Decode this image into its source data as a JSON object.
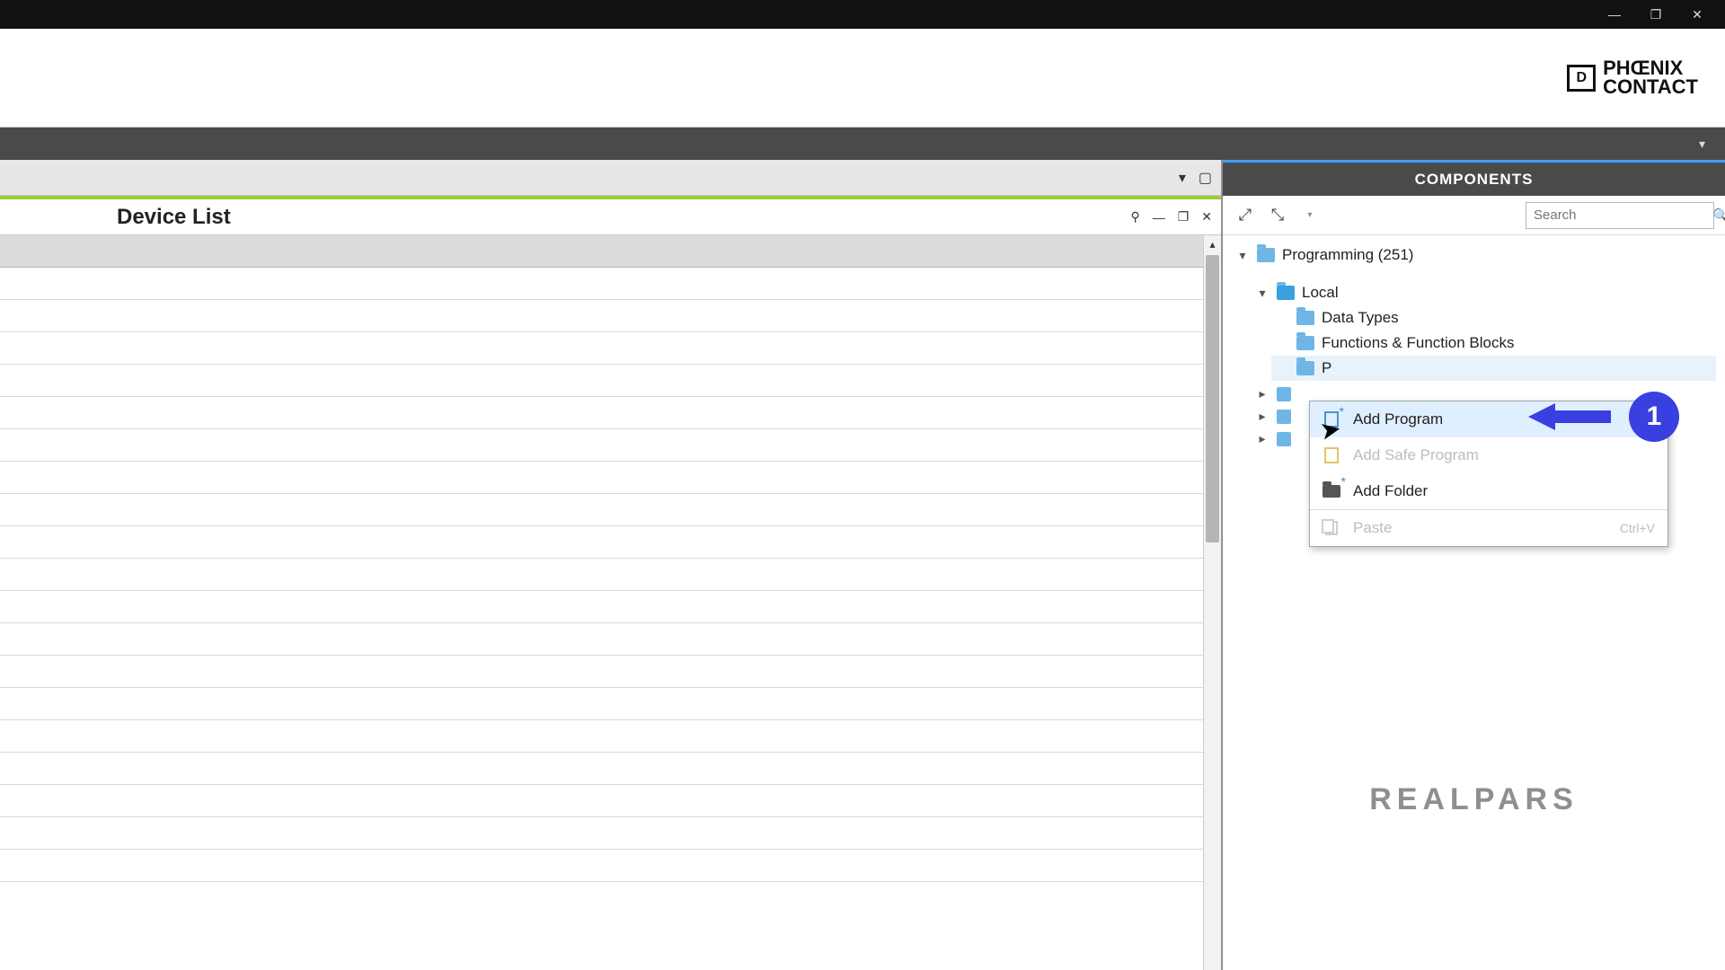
{
  "window": {
    "controls": {
      "min": "—",
      "max": "❐",
      "close": "✕"
    }
  },
  "brand": {
    "name_top": "PHŒNIX",
    "name_bottom": "CONTACT",
    "mark": "⎔"
  },
  "workspace": {
    "tab_title": "Device List",
    "tab_controls": {
      "pin": "⚲",
      "min": "—",
      "max": "❐",
      "close": "✕"
    }
  },
  "panel": {
    "title": "COMPONENTS",
    "search_placeholder": "Search"
  },
  "tree": {
    "root": {
      "label": "Programming (251)"
    },
    "local": {
      "label": "Local"
    },
    "data_types": {
      "label": "Data Types"
    },
    "ffb": {
      "label": "Functions & Function Blocks"
    },
    "programs_partial": {
      "label": "P"
    }
  },
  "context_menu": {
    "add_program": "Add Program",
    "add_safe_program": "Add Safe Program",
    "add_folder": "Add Folder",
    "paste": "Paste",
    "paste_shortcut": "Ctrl+V"
  },
  "callout": {
    "number": "1"
  },
  "watermark": "REALPARS"
}
